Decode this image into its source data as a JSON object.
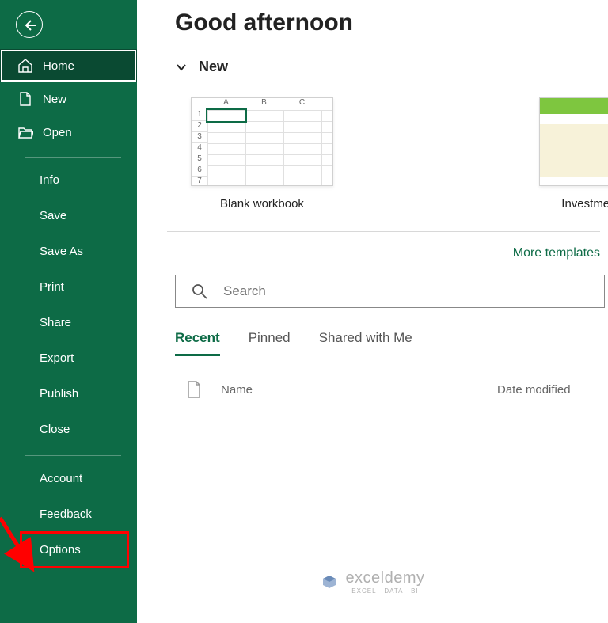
{
  "sidebar": {
    "primary": [
      {
        "label": "Home",
        "icon": "home-icon",
        "selected": true
      },
      {
        "label": "New",
        "icon": "file-icon"
      },
      {
        "label": "Open",
        "icon": "folder-icon"
      }
    ],
    "secondary": [
      "Info",
      "Save",
      "Save As",
      "Print",
      "Share",
      "Export",
      "Publish",
      "Close"
    ],
    "tertiary": [
      "Account",
      "Feedback",
      "Options"
    ]
  },
  "main": {
    "greeting": "Good afternoon",
    "new_section": "New",
    "templates": [
      {
        "label": "Blank workbook"
      },
      {
        "label": "Investment tracker"
      }
    ],
    "more_link": "More templates",
    "search_placeholder": "Search",
    "tabs": [
      {
        "label": "Recent",
        "active": true
      },
      {
        "label": "Pinned"
      },
      {
        "label": "Shared with Me"
      }
    ],
    "list_columns": {
      "name": "Name",
      "date": "Date modified"
    }
  },
  "watermark": {
    "brand": "exceldemy",
    "tagline": "EXCEL · DATA · BI"
  }
}
